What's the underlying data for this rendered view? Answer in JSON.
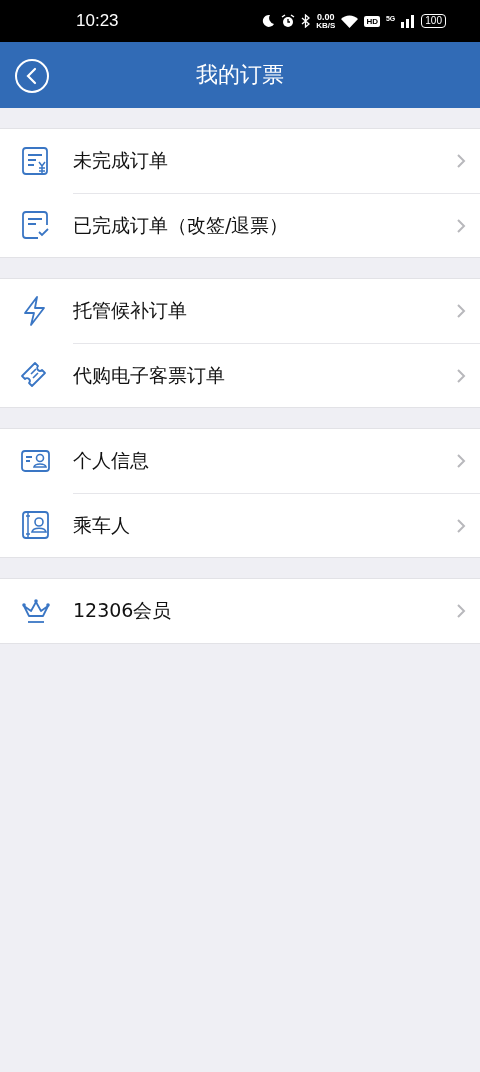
{
  "status_bar": {
    "time": "10:23",
    "net_speed": "0.00",
    "net_unit": "KB/S",
    "hd": "HD",
    "network": "5G",
    "battery": "100"
  },
  "header": {
    "title": "我的订票"
  },
  "groups": [
    {
      "items": [
        {
          "kind": "bill",
          "label": "未完成订单"
        },
        {
          "kind": "done",
          "label": "已完成订单（改签/退票）"
        }
      ]
    },
    {
      "items": [
        {
          "kind": "bolt",
          "label": "托管候补订单"
        },
        {
          "kind": "ticket",
          "label": "代购电子客票订单"
        }
      ]
    },
    {
      "items": [
        {
          "kind": "card",
          "label": "个人信息"
        },
        {
          "kind": "passenger",
          "label": "乘车人"
        }
      ]
    },
    {
      "items": [
        {
          "kind": "crown",
          "label": "12306会员"
        }
      ]
    }
  ]
}
